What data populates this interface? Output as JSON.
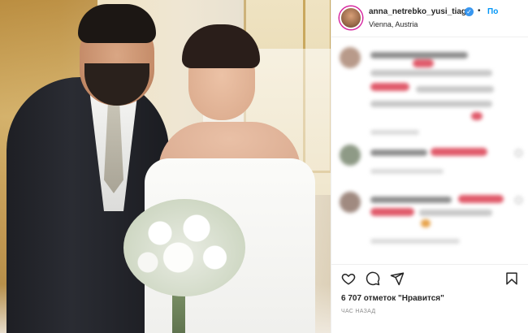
{
  "post": {
    "username": "anna_netrebko_yusi_tiago",
    "verified_symbol": "✓",
    "separator": "•",
    "follow_label": "По",
    "location": "Vienna, Austria"
  },
  "photo": {
    "description_icon": "wedding-photo"
  },
  "engagement": {
    "likes_text": "6 707 отметок \"Нравится\"",
    "time_text": "ЧАС НАЗАД"
  },
  "icons": {
    "like": "heart-icon",
    "comment": "comment-icon",
    "share": "share-icon",
    "save": "bookmark-icon"
  },
  "colors": {
    "accent": "#0095f6",
    "verified": "#3897f0",
    "text": "#262626",
    "muted": "#8e8e8e"
  }
}
